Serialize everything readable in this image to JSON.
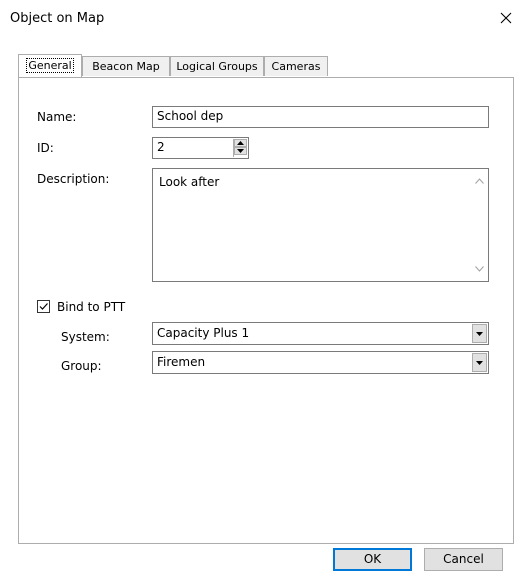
{
  "window": {
    "title": "Object on Map"
  },
  "icons": {
    "close": "close-icon",
    "spin_up": "arrow-up-icon",
    "spin_down": "arrow-down-icon",
    "combo_arrow": "chevron-down-icon",
    "check": "checkmark-icon"
  },
  "tabs": [
    {
      "label": "General",
      "active": true
    },
    {
      "label": "Beacon Map",
      "active": false
    },
    {
      "label": "Logical Groups",
      "active": false
    },
    {
      "label": "Cameras",
      "active": false
    }
  ],
  "form": {
    "name_label": "Name:",
    "name_value": "School dep",
    "id_label": "ID:",
    "id_value": "2",
    "description_label": "Description:",
    "description_value": "Look after",
    "bind_label": "Bind to PTT",
    "bind_checked": true,
    "system_label": "System:",
    "system_value": "Capacity Plus 1",
    "group_label": "Group:",
    "group_value": "Firemen"
  },
  "buttons": {
    "ok": "OK",
    "cancel": "Cancel"
  },
  "colors": {
    "accent": "#0078d7",
    "border": "#adadad"
  }
}
